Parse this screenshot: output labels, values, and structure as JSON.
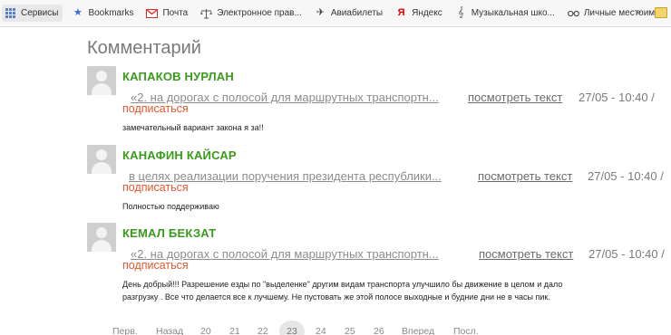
{
  "bookmarks": {
    "items": [
      {
        "label": "Сервисы",
        "icon": "apps-grid-icon"
      },
      {
        "label": "Bookmarks",
        "icon": "star-icon",
        "color": "#3b6fd4"
      },
      {
        "label": "Почта",
        "icon": "gmail-icon",
        "color": "#d93025"
      },
      {
        "label": "Электронное прав...",
        "icon": "scales-icon"
      },
      {
        "label": "Авиабилеты",
        "icon": "airplane-icon"
      },
      {
        "label": "Яндекс",
        "icon": "yandex-icon",
        "color": "#e00000"
      },
      {
        "label": "Музыкальная шко...",
        "icon": "treble-clef-icon"
      },
      {
        "label": "Личные местоиме...",
        "icon": "glasses-icon"
      }
    ],
    "more": "»"
  },
  "page": {
    "title": "Комментарий"
  },
  "comments": [
    {
      "author": "КАПАКОВ НУРЛАН",
      "topic": "«2. на дорогах с полосой для маршрутных транспортн...",
      "view_label": "посмотреть текст",
      "date": "27/05 - 10:40 /",
      "subscribe": "подписаться",
      "text": "замечательный вариант закона я за!!"
    },
    {
      "author": "КАНАФИН КАЙСАР",
      "topic": "в целях реализации поручения президента республики...",
      "view_label": "посмотреть текст",
      "date": "27/05 - 10:40 /",
      "subscribe": "подписаться",
      "text": "Полностью поддерживаю"
    },
    {
      "author": "КЕМАЛ БЕКЗАТ",
      "topic": "«2. на дорогах с полосой для маршрутных транспортн...",
      "view_label": "посмотреть текст",
      "date": "27/05 - 10:40 /",
      "subscribe": "подписаться",
      "text_line1": "День добрый!!! Разрешение езды по \"выделенке\" другим видам транспорта улучшило бы движение в целом и дало",
      "text_line2": "разгрузку . Все что делается все к лучшему. Не пустовать же этой полосе выходные и будние дни не в часы пик."
    }
  ],
  "pager": {
    "first": "Перв.",
    "prev": "Назад",
    "pages": [
      "20",
      "21",
      "22",
      "23",
      "24",
      "25",
      "26"
    ],
    "current": "23",
    "next": "Вперед",
    "last": "Посл."
  },
  "colors": {
    "author": "#3a9a1c",
    "subscribe": "#e0582e"
  }
}
